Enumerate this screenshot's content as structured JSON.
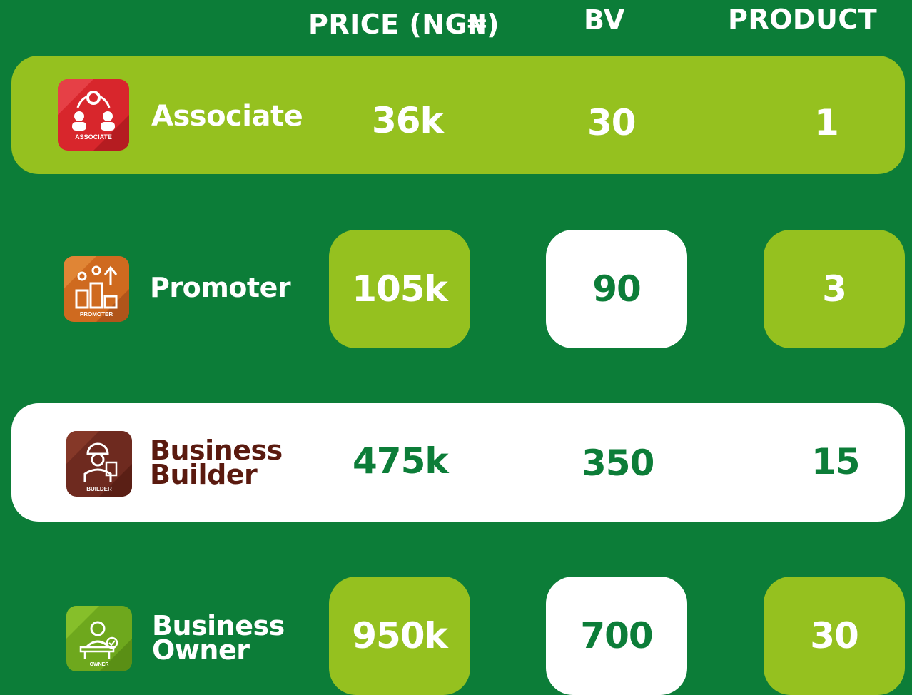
{
  "columns": {
    "price": "PRICE (NG₦)",
    "bv": "BV",
    "product": "PRODUCT"
  },
  "tiers": [
    {
      "name": "Associate",
      "badge": "ASSOCIATE",
      "price": "36k",
      "bv": "30",
      "product": "1",
      "icon": "people-network-icon",
      "badge_color": "#d8262c"
    },
    {
      "name": "Promoter",
      "badge": "PROMOTER",
      "price": "105k",
      "bv": "90",
      "product": "3",
      "icon": "podium-growth-icon",
      "badge_color": "#cf6a1f"
    },
    {
      "name_line1": "Business",
      "name_line2": "Builder",
      "badge": "BUILDER",
      "price": "475k",
      "bv": "350",
      "product": "15",
      "icon": "construction-worker-icon",
      "badge_color": "#6e2a1f"
    },
    {
      "name_line1": "Business",
      "name_line2": "Owner",
      "badge": "OWNER",
      "price": "950k",
      "bv": "700",
      "product": "30",
      "icon": "executive-desk-icon",
      "badge_color": "#6ea81d"
    }
  ],
  "colors": {
    "background": "#0c7d38",
    "lime": "#95c11f",
    "white": "#ffffff"
  }
}
